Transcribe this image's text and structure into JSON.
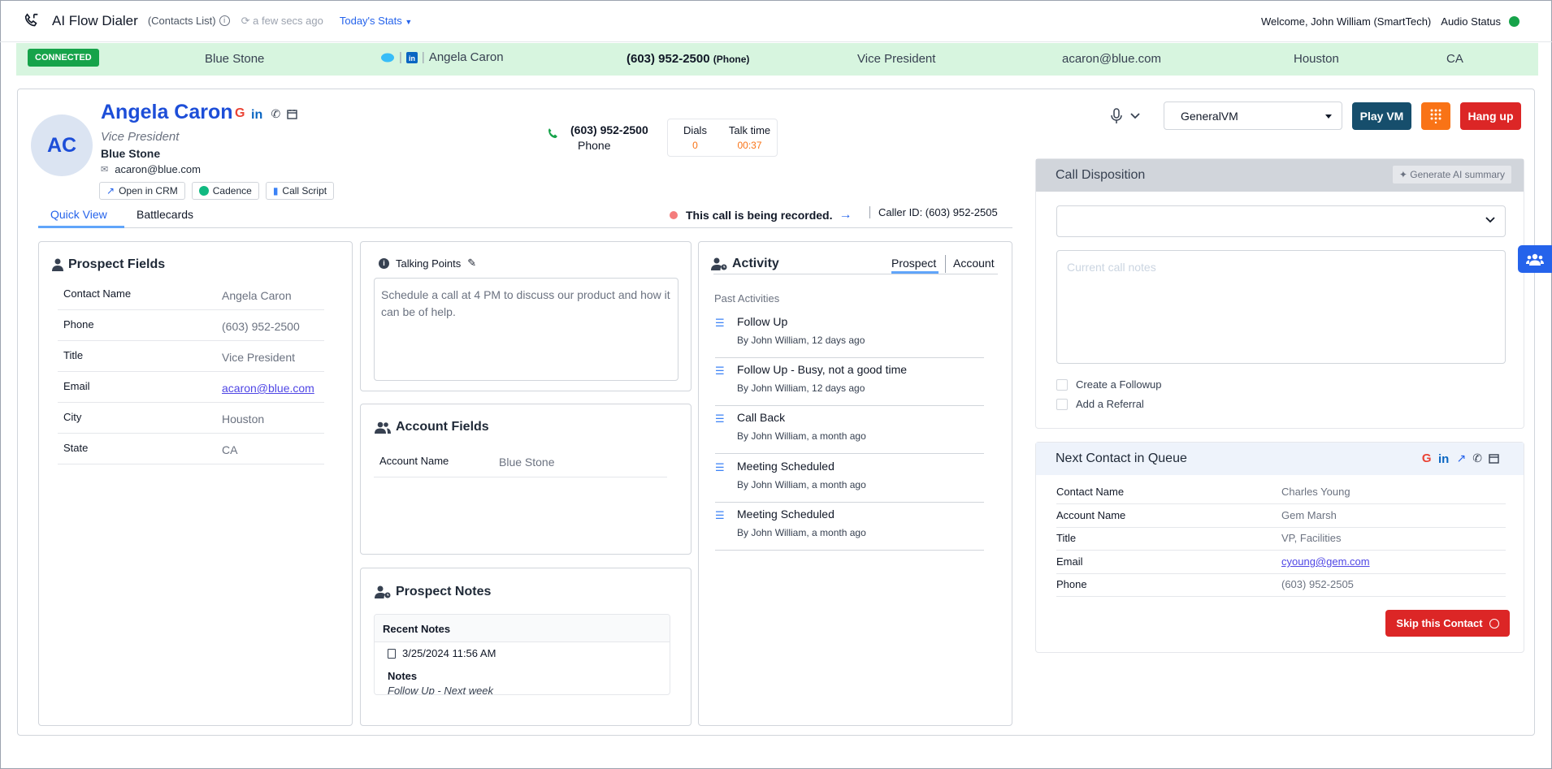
{
  "topbar": {
    "app_title": "AI Flow Dialer",
    "list_label": "(Contacts List)",
    "refresh_text": "a few secs ago",
    "stats_link": "Today's Stats",
    "welcome": "Welcome, John William (SmartTech)",
    "audio_status": "Audio Status"
  },
  "connbar": {
    "badge": "CONNECTED",
    "company": "Blue Stone",
    "name": "Angela Caron",
    "phone": "(603) 952-2500",
    "phone_type": "(Phone)",
    "title": "Vice President",
    "email": "acaron@blue.com",
    "city": "Houston",
    "state": "CA"
  },
  "prospect": {
    "initials": "AC",
    "name": "Angela Caron",
    "title": "Vice President",
    "company": "Blue Stone",
    "email": "acaron@blue.com",
    "buttons": {
      "crm": "Open in CRM",
      "cadence": "Cadence",
      "script": "Call Script"
    }
  },
  "call": {
    "number": "(603) 952-2500",
    "type": "Phone",
    "dials_label": "Dials",
    "dials_value": "0",
    "talk_label": "Talk time",
    "talk_value": "00:37",
    "recording_text": "This call is being recorded.",
    "caller_id": "Caller ID: (603) 952-2505"
  },
  "tabs": {
    "quick_view": "Quick View",
    "battlecards": "Battlecards"
  },
  "prospect_fields": {
    "title": "Prospect Fields",
    "rows": [
      {
        "k": "Contact Name",
        "v": "Angela Caron"
      },
      {
        "k": "Phone",
        "v": "(603) 952-2500"
      },
      {
        "k": "Title",
        "v": "Vice President"
      },
      {
        "k": "Email",
        "v": "acaron@blue.com"
      },
      {
        "k": "City",
        "v": "Houston"
      },
      {
        "k": "State",
        "v": "CA"
      }
    ]
  },
  "talking_points": {
    "title": "Talking Points",
    "text": "Schedule a call at 4 PM to discuss our product and how it can be of help."
  },
  "account_fields": {
    "title": "Account Fields",
    "rows": [
      {
        "k": "Account Name",
        "v": "Blue Stone"
      }
    ]
  },
  "prospect_notes": {
    "title": "Prospect Notes",
    "recent": "Recent Notes",
    "date": "3/25/2024 11:56 AM",
    "notes_label": "Notes",
    "note_text": "Follow Up - Next week"
  },
  "activity": {
    "title": "Activity",
    "tab_prospect": "Prospect",
    "tab_account": "Account",
    "past": "Past Activities",
    "items": [
      {
        "t": "Follow Up",
        "s": "By John William, 12 days ago"
      },
      {
        "t": "Follow Up - Busy, not a good time",
        "s": "By John William, 12 days ago"
      },
      {
        "t": "Call Back",
        "s": "By John William, a month ago"
      },
      {
        "t": "Meeting Scheduled",
        "s": "By John William, a month ago"
      },
      {
        "t": "Meeting Scheduled",
        "s": "By John William, a month ago"
      }
    ]
  },
  "controls": {
    "vm_select": "GeneralVM",
    "play_vm": "Play VM",
    "hang_up": "Hang up"
  },
  "disposition": {
    "title": "Call Disposition",
    "gen_ai": "Generate AI summary",
    "notes_placeholder": "Current call notes",
    "followup": "Create a Followup",
    "referral": "Add a Referral"
  },
  "queue": {
    "title": "Next Contact in Queue",
    "rows": [
      {
        "k": "Contact Name",
        "v": "Charles Young"
      },
      {
        "k": "Account Name",
        "v": "Gem Marsh"
      },
      {
        "k": "Title",
        "v": "VP, Facilities"
      },
      {
        "k": "Email",
        "v": "cyoung@gem.com"
      },
      {
        "k": "Phone",
        "v": "(603) 952-2505"
      }
    ],
    "skip": "Skip this Contact"
  },
  "colors": {
    "accent": "#2563eb",
    "connected": "#16a34a",
    "danger": "#dc2626",
    "orange": "#f97316",
    "dark_teal": "#164e6c"
  }
}
